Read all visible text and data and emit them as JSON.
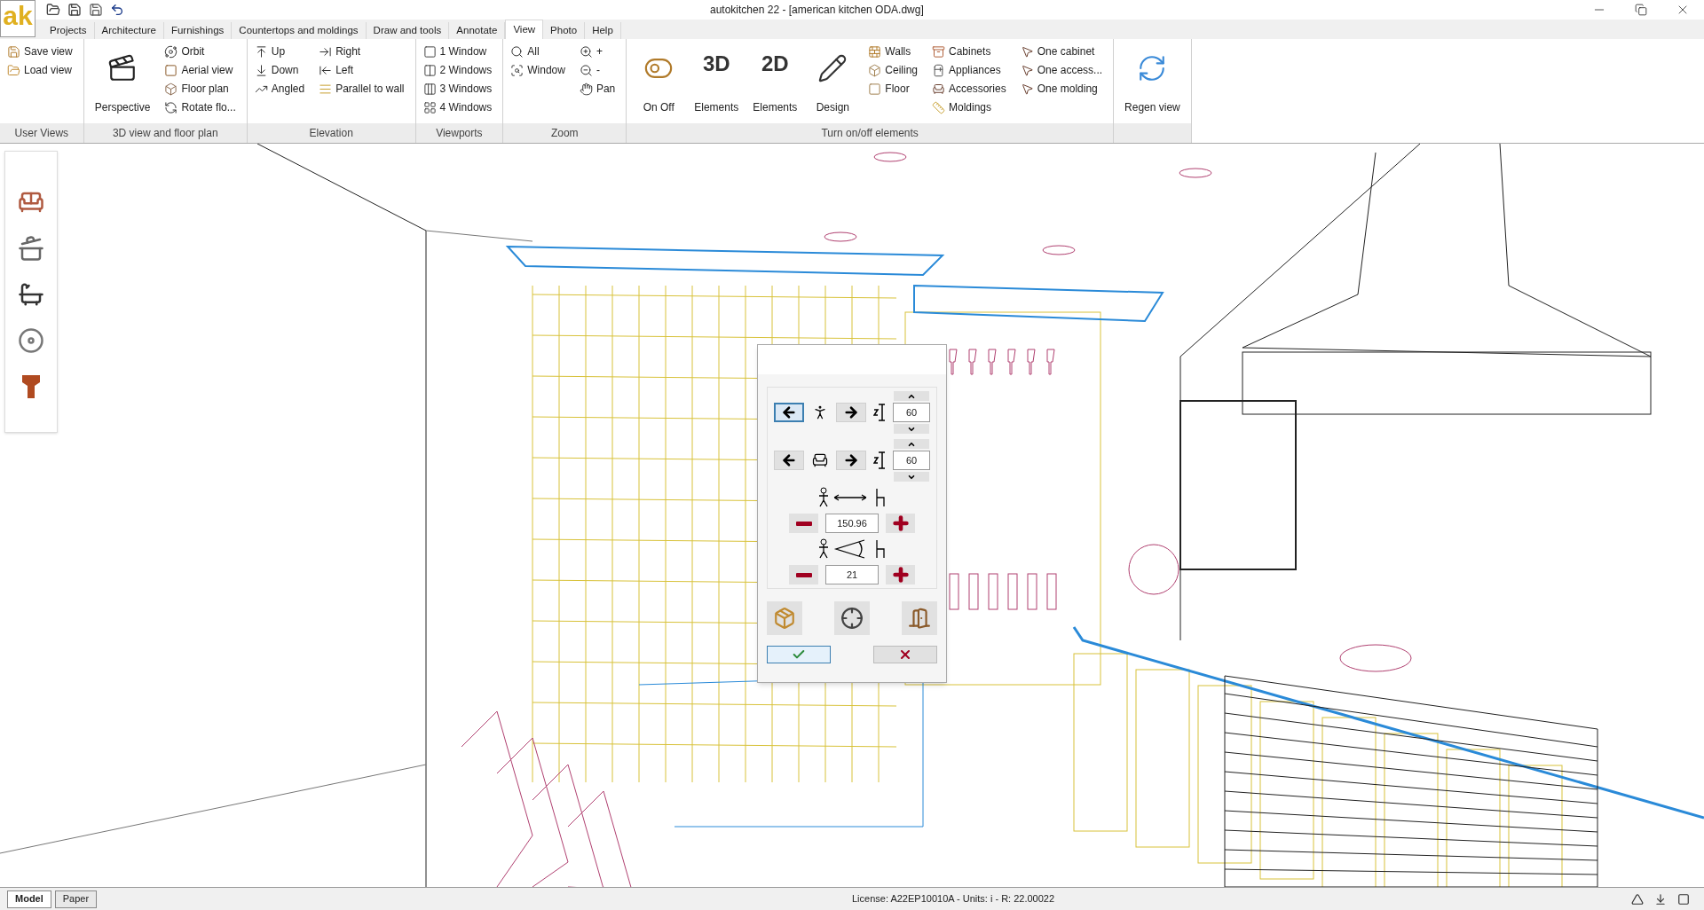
{
  "window": {
    "title": "autokitchen 22 - [american kitchen ODA.dwg]"
  },
  "logo": {
    "text": "ak"
  },
  "tabs": [
    {
      "label": "Projects",
      "selected": false
    },
    {
      "label": "Architecture",
      "selected": false
    },
    {
      "label": "Furnishings",
      "selected": false
    },
    {
      "label": "Countertops and moldings",
      "selected": false
    },
    {
      "label": "Draw and tools",
      "selected": false
    },
    {
      "label": "Annotate",
      "selected": false
    },
    {
      "label": "View",
      "selected": true
    },
    {
      "label": "Photo",
      "selected": false
    },
    {
      "label": "Help",
      "selected": false
    }
  ],
  "ribbon_groups": [
    {
      "label": "User Views",
      "columns": [
        {
          "kind": "small",
          "items": [
            {
              "label": "Save view"
            },
            {
              "label": "Load view"
            }
          ]
        }
      ]
    },
    {
      "label": "3D view and floor plan",
      "columns": [
        {
          "kind": "large",
          "items": [
            {
              "label": "Perspective"
            }
          ]
        },
        {
          "kind": "small",
          "items": [
            {
              "label": "Orbit"
            },
            {
              "label": "Aerial view"
            },
            {
              "label": "Floor plan"
            },
            {
              "label": "Rotate flo..."
            }
          ]
        }
      ]
    },
    {
      "label": "Elevation",
      "columns": [
        {
          "kind": "small",
          "items": [
            {
              "label": "Up"
            },
            {
              "label": "Down"
            },
            {
              "label": "Angled"
            }
          ]
        },
        {
          "kind": "small",
          "items": [
            {
              "label": "Right"
            },
            {
              "label": "Left"
            },
            {
              "label": "Parallel to wall"
            }
          ]
        }
      ]
    },
    {
      "label": "Viewports",
      "columns": [
        {
          "kind": "small",
          "items": [
            {
              "label": "1 Window"
            },
            {
              "label": "2 Windows"
            },
            {
              "label": "3 Windows"
            },
            {
              "label": "4 Windows"
            }
          ]
        }
      ]
    },
    {
      "label": "Zoom",
      "columns": [
        {
          "kind": "small",
          "items": [
            {
              "label": "All"
            },
            {
              "label": "Window"
            }
          ]
        },
        {
          "kind": "small",
          "items": [
            {
              "label": "+"
            },
            {
              "label": "-"
            },
            {
              "label": "Pan"
            }
          ]
        }
      ]
    },
    {
      "label": "Turn on/off elements",
      "columns": [
        {
          "kind": "large",
          "items": [
            {
              "label": "On Off"
            },
            {
              "label": "Elements",
              "glyph": "3D"
            },
            {
              "label": "Elements",
              "glyph": "2D"
            },
            {
              "label": "Design"
            }
          ]
        },
        {
          "kind": "small",
          "items": [
            {
              "label": "Walls"
            },
            {
              "label": "Ceiling"
            },
            {
              "label": "Floor"
            }
          ]
        },
        {
          "kind": "small",
          "items": [
            {
              "label": "Cabinets"
            },
            {
              "label": "Appliances"
            },
            {
              "label": "Accessories"
            },
            {
              "label": "Moldings"
            }
          ]
        },
        {
          "kind": "small",
          "items": [
            {
              "label": "One cabinet"
            },
            {
              "label": "One access..."
            },
            {
              "label": "One molding"
            }
          ]
        }
      ]
    },
    {
      "columns": [
        {
          "kind": "large",
          "items": [
            {
              "label": "Regen view"
            }
          ]
        }
      ]
    }
  ],
  "camera_dialog": {
    "height_rows": [
      {
        "left_selected": true,
        "right_selected": false,
        "value": "60"
      },
      {
        "left_selected": false,
        "right_selected": false,
        "value": "60"
      }
    ],
    "distance": "150.96",
    "angle": "21"
  },
  "layout_tabs": [
    {
      "label": "Model",
      "selected": true
    },
    {
      "label": "Paper",
      "selected": false
    }
  ],
  "status_text": "License: A22EP10010A - Units: i - R: 22.00022"
}
